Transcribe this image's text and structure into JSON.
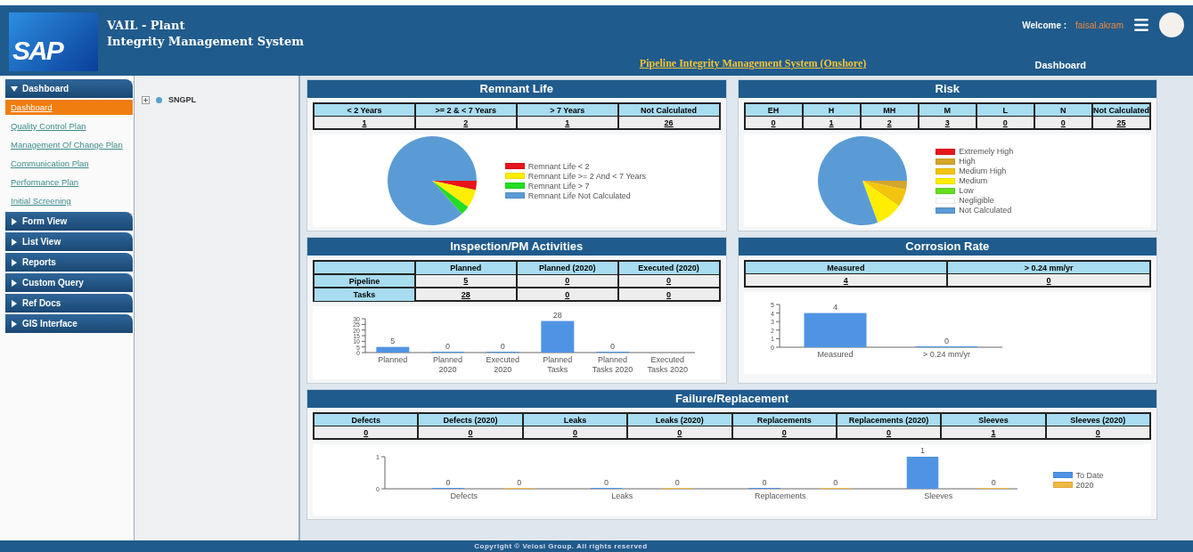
{
  "header": {
    "logo_text": "SAP",
    "title_lines": [
      "VAIL - Plant",
      "Integrity Management System"
    ],
    "welcome_label": "Welcome :",
    "username": "faisal.akram",
    "subtitle": "Pipeline Integrity Management System (Onshore)",
    "page_label": "Dashboard"
  },
  "sidebar": {
    "sections": [
      {
        "label": "Dashboard",
        "expanded": true,
        "items": [
          {
            "label": "Dashboard",
            "selected": true
          },
          {
            "label": "Quality Control Plan",
            "selected": false
          },
          {
            "label": "Management Of Change Plan",
            "selected": false
          },
          {
            "label": "Communication Plan",
            "selected": false
          },
          {
            "label": "Performance Plan",
            "selected": false
          },
          {
            "label": "Initial Screening",
            "selected": false
          }
        ]
      },
      {
        "label": "Form View",
        "expanded": false
      },
      {
        "label": "List View",
        "expanded": false
      },
      {
        "label": "Reports",
        "expanded": false
      },
      {
        "label": "Custom Query",
        "expanded": false
      },
      {
        "label": "Ref Docs",
        "expanded": false
      },
      {
        "label": "GIS Interface",
        "expanded": false
      }
    ]
  },
  "tree": {
    "nodes": [
      {
        "label": "SNGPL",
        "expanded": false
      }
    ]
  },
  "cards": [
    {
      "title": "Remnant Life",
      "table": {
        "columns": [
          "< 2 Years",
          ">= 2 & < 7 Years",
          "> 7 Years",
          "Not Calculated"
        ],
        "rows": [
          {
            "cells": [
              "1",
              "2",
              "1",
              "26"
            ]
          }
        ]
      },
      "chart_data": {
        "type": "pie",
        "categories": [
          "Remnant Life < 2",
          "Remnant Life >= 2 And < 7 Years",
          "Remnant Life > 7",
          "Remnant Life Not Calculated"
        ],
        "values": [
          1,
          2,
          1,
          26
        ],
        "colors": [
          "#e8141c",
          "#ffee00",
          "#22dd22",
          "#5b9bd5"
        ],
        "legend": "right"
      }
    },
    {
      "title": "Risk",
      "table": {
        "columns": [
          "EH",
          "H",
          "MH",
          "M",
          "L",
          "N",
          "Not Calculated"
        ],
        "rows": [
          {
            "cells": [
              "0",
              "1",
              "2",
              "3",
              "0",
              "0",
              "25"
            ]
          }
        ]
      },
      "chart_data": {
        "type": "pie",
        "categories": [
          "Extremely High",
          "High",
          "Medium High",
          "Medium",
          "Low",
          "Negligible",
          "Not Calculated"
        ],
        "values": [
          0,
          3.2,
          6.5,
          9.7,
          0,
          0,
          80.6
        ],
        "colors": [
          "#e8141c",
          "#d4a62a",
          "#f2c40e",
          "#ffee00",
          "#66dd22",
          "#ffffff",
          "#5b9bd5"
        ],
        "legend": "right"
      }
    },
    {
      "title": "Inspection/PM Activities",
      "table": {
        "columns": [
          "",
          "Planned",
          "Planned (2020)",
          "Executed (2020)"
        ],
        "row_headers": true,
        "rows": [
          {
            "cells": [
              "Pipeline",
              "5",
              "0",
              "0"
            ]
          },
          {
            "cells": [
              "Tasks",
              "28",
              "0",
              "0"
            ]
          }
        ]
      },
      "chart_data": {
        "type": "bar",
        "categories": [
          "Planned",
          "Planned 2020",
          "Executed 2020",
          "Planned Tasks",
          "Planned Tasks 2020",
          "Executed Tasks 2020"
        ],
        "values": [
          5,
          0,
          0,
          28,
          0,
          null
        ],
        "ylim": [
          0,
          30
        ],
        "yticks": [
          0,
          5,
          10,
          15,
          20,
          25,
          30
        ],
        "data_labels": true
      }
    },
    {
      "title": "Corrosion Rate",
      "table": {
        "columns": [
          "Measured",
          "> 0.24 mm/yr"
        ],
        "rows": [
          {
            "cells": [
              "4",
              "0"
            ]
          }
        ]
      },
      "chart_data": {
        "type": "bar",
        "categories": [
          "Measured",
          "> 0.24 mm/yr"
        ],
        "values": [
          4,
          0
        ],
        "ylim": [
          0,
          5
        ],
        "yticks": [
          0,
          1,
          2,
          3,
          4,
          5
        ],
        "data_labels": true
      }
    }
  ],
  "failure_card": {
    "title": "Failure/Replacement",
    "table": {
      "columns": [
        "Defects",
        "Defects (2020)",
        "Leaks",
        "Leaks (2020)",
        "Replacements",
        "Replacements (2020)",
        "Sleeves",
        "Sleeves (2020)"
      ],
      "rows": [
        {
          "cells": [
            "0",
            "0",
            "0",
            "0",
            "0",
            "0",
            "1",
            "0"
          ]
        }
      ]
    },
    "chart_data": {
      "type": "bar",
      "categories": [
        "Defects",
        "Leaks",
        "Replacements",
        "Sleeves"
      ],
      "series": [
        {
          "name": "To Date",
          "color": "#4f94e4",
          "values": [
            0,
            0,
            0,
            1
          ]
        },
        {
          "name": "2020",
          "color": "#f0b840",
          "values": [
            0,
            0,
            0,
            0
          ]
        }
      ],
      "ylim": [
        0,
        1
      ],
      "yticks": [
        0,
        1
      ],
      "value_labels": [
        [
          "0",
          "0",
          "0",
          "1"
        ],
        [
          "0",
          "0",
          "0",
          "0"
        ]
      ],
      "legend": "right"
    }
  },
  "footer": {
    "text": "Copyright © Velosi Group. All rights reserved"
  }
}
